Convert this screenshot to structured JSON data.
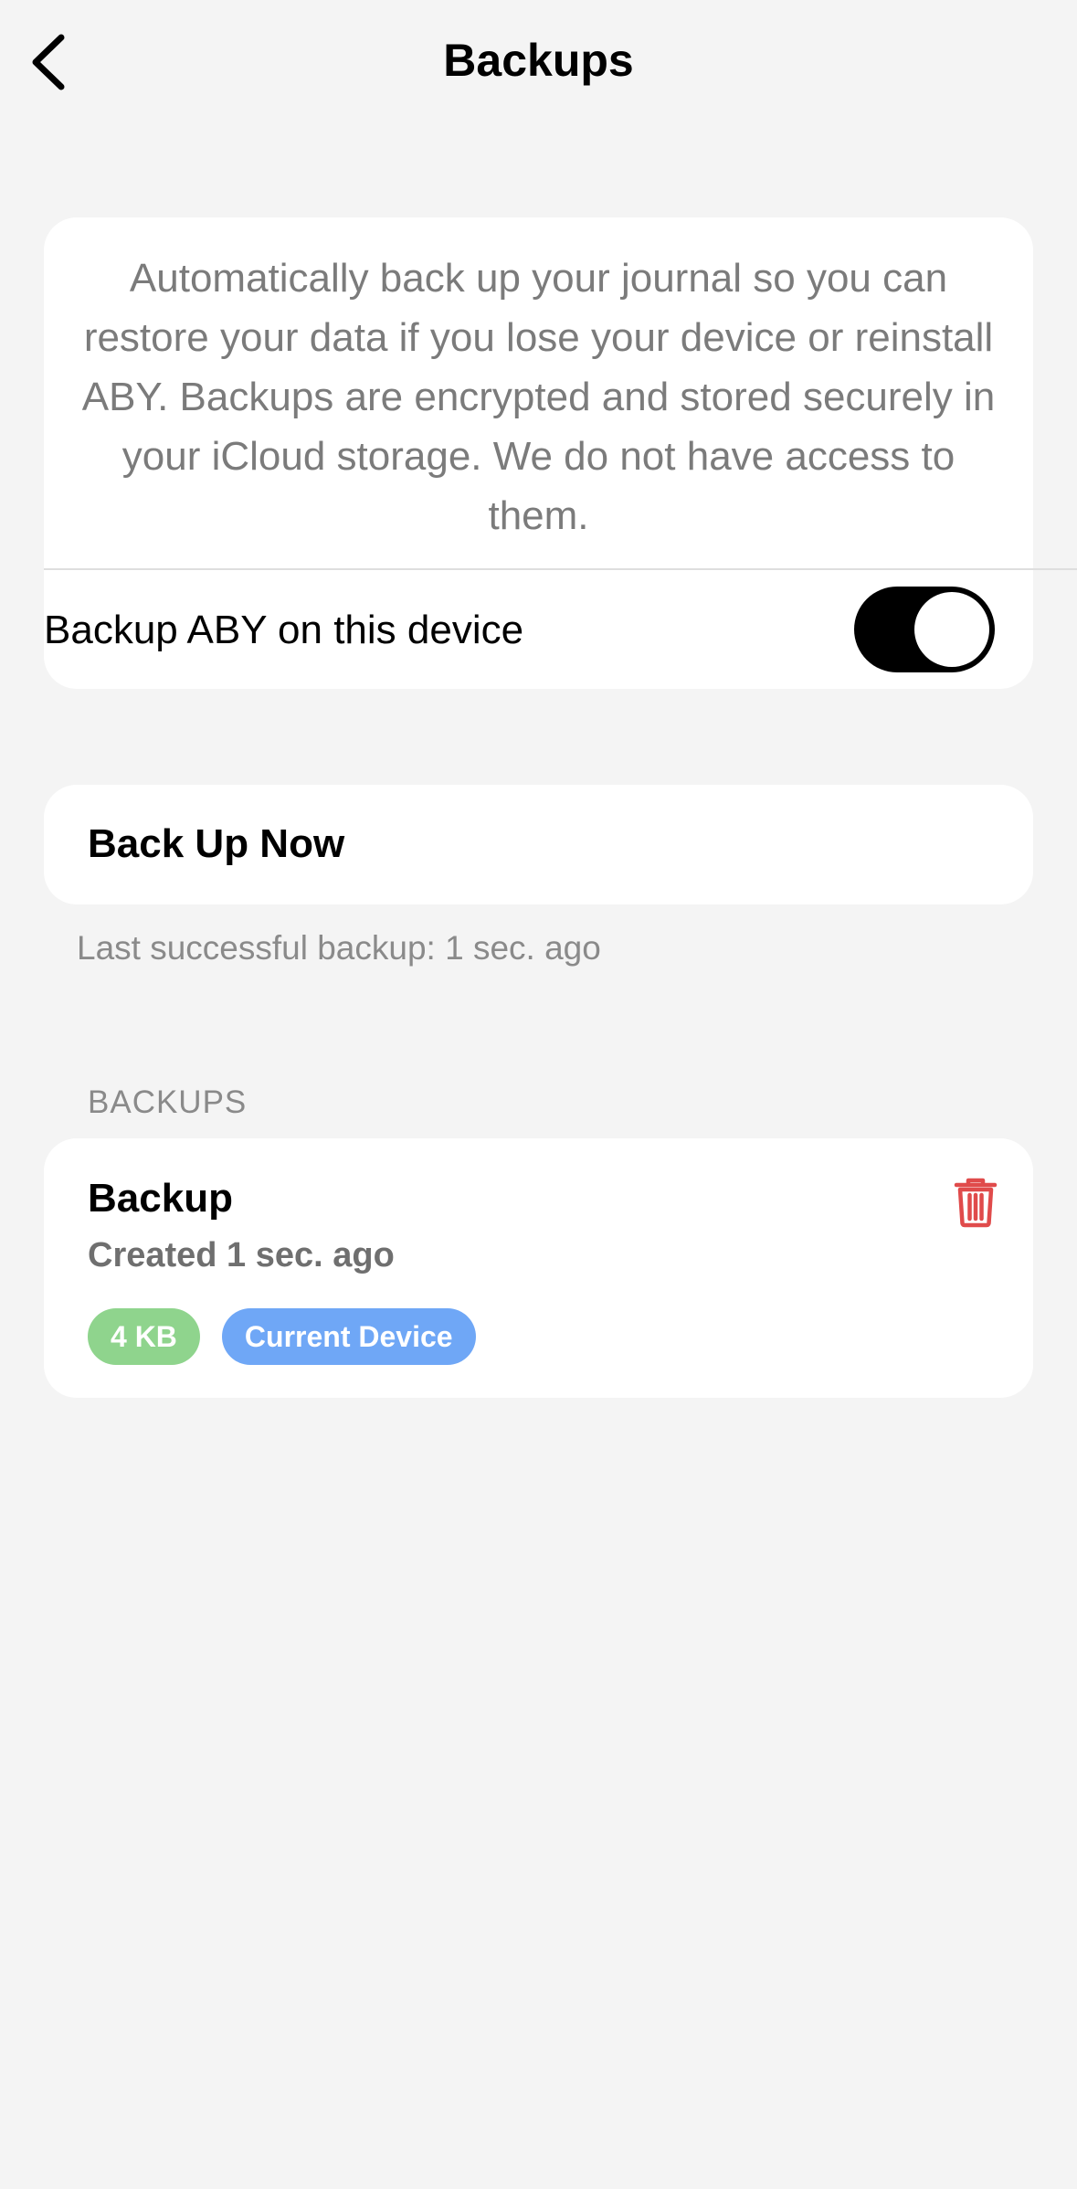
{
  "header": {
    "title": "Backups",
    "back_icon": "chevron-left-icon"
  },
  "auto_backup": {
    "description": "Automatically back up your journal so you can restore your data if you lose your device or reinstall ABY. Backups are encrypted and stored securely in your iCloud storage. We do not have access to them.",
    "toggle_label": "Backup ABY on this device",
    "toggle_on": true
  },
  "backup_now": {
    "label": "Back Up Now",
    "last_backup": "Last successful backup: 1 sec. ago"
  },
  "backups_section": {
    "header": "BACKUPS",
    "items": [
      {
        "title": "Backup",
        "created": "Created 1 sec. ago",
        "size": "4 KB",
        "device": "Current Device",
        "delete_icon": "trash-icon"
      }
    ]
  },
  "colors": {
    "background": "#f4f4f4",
    "card": "#ffffff",
    "delete_red": "#e04b4b",
    "size_badge": "#8fd48d",
    "device_badge": "#6fa7f6",
    "toggle_on": "#000000"
  }
}
